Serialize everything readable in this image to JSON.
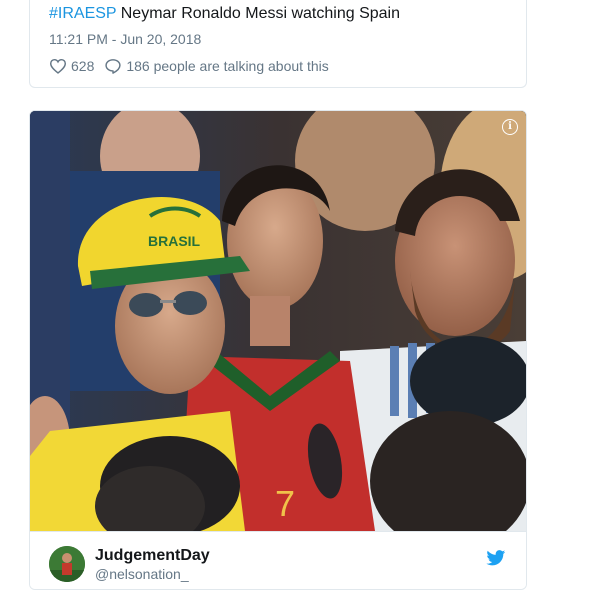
{
  "tweet": {
    "hashtag": "#IRAESP",
    "text": " Neymar Ronaldo Messi watching Spain",
    "timestamp": "11:21 PM - Jun 20, 2018",
    "likes": "628",
    "replies_text": "186 people are talking about this"
  },
  "embed": {
    "author_name": "JudgementDay",
    "author_handle": "@nelsonation_",
    "info_icon": "info-icon",
    "brand_icon": "twitter-bird-icon"
  },
  "photo": {
    "cap_text": "BRASIL"
  },
  "colors": {
    "link": "#1b95e0",
    "text": "#14171a",
    "muted": "#657786",
    "border": "#e1e8ed"
  }
}
